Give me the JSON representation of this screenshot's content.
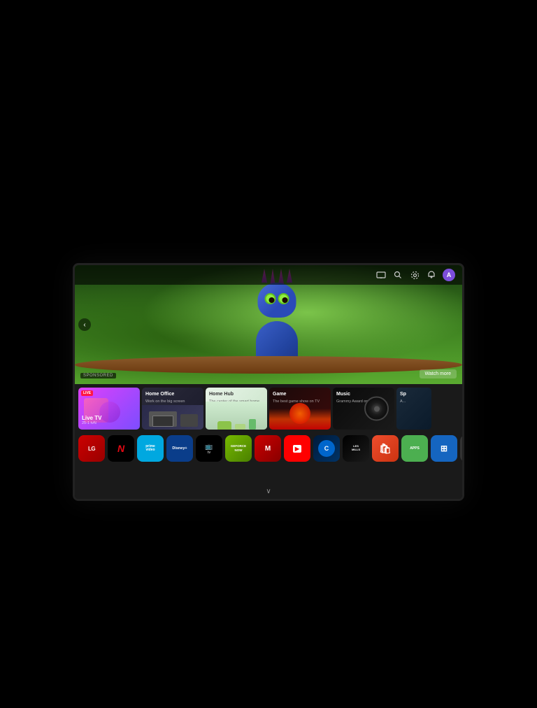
{
  "page": {
    "background": "#000000"
  },
  "tv": {
    "topbar": {
      "icons": [
        "screen-icon",
        "search-icon",
        "settings-icon",
        "notification-icon"
      ],
      "avatar_label": "A"
    },
    "hero": {
      "sponsored_text": "SPONSORED",
      "watch_more_label": "Watch more",
      "nav_left": "‹"
    },
    "categories": [
      {
        "id": "live-tv",
        "badge": "LIVE",
        "title": "Live TV",
        "subtitle": "25-1  tvN",
        "type": "live"
      },
      {
        "id": "home-office",
        "label": "Home Office",
        "sublabel": "Work on the big screen",
        "type": "office"
      },
      {
        "id": "home-hub",
        "label": "Home Hub",
        "sublabel": "The center of the smart home",
        "type": "hub"
      },
      {
        "id": "game",
        "label": "Game",
        "sublabel": "The best game show on TV",
        "type": "game"
      },
      {
        "id": "music",
        "label": "Music",
        "sublabel": "Grammy Award on TV",
        "type": "music"
      },
      {
        "id": "sp",
        "label": "Sp",
        "sublabel": "A...",
        "type": "sp"
      }
    ],
    "apps": [
      {
        "id": "lg",
        "label": "LG",
        "class": "app-lg"
      },
      {
        "id": "netflix",
        "label": "N",
        "class": "app-netflix"
      },
      {
        "id": "prime",
        "label": "prime\nvideo",
        "class": "app-prime"
      },
      {
        "id": "disney",
        "label": "Disney+",
        "class": "app-disney"
      },
      {
        "id": "apple",
        "label": "tv",
        "class": "app-apple"
      },
      {
        "id": "geforce",
        "label": "GEFORCE NOW",
        "class": "app-geforce"
      },
      {
        "id": "mcafee",
        "label": "M",
        "class": "app-mcafee"
      },
      {
        "id": "youtube",
        "label": "▶",
        "class": "app-youtube"
      },
      {
        "id": "concur",
        "label": "C",
        "class": "app-concur"
      },
      {
        "id": "lesmill",
        "label": "LESMILLS",
        "class": "app-lesmill"
      },
      {
        "id": "shopee",
        "label": "S",
        "class": "app-shopee"
      },
      {
        "id": "apps",
        "label": "APPS",
        "class": "app-apps"
      },
      {
        "id": "multi",
        "label": "⊞",
        "class": "app-multi"
      },
      {
        "id": "extra",
        "label": "▶",
        "class": "app-extra"
      }
    ]
  }
}
